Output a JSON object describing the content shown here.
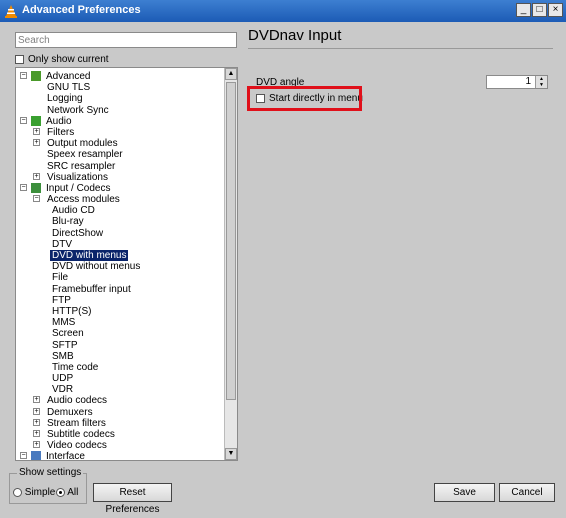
{
  "window": {
    "title": "Advanced Preferences",
    "controls": [
      "_",
      "□",
      "×"
    ]
  },
  "search": {
    "placeholder": "Search"
  },
  "only_show_current": {
    "label": "Only show current",
    "checked": false
  },
  "tree": {
    "items": [
      {
        "label": "Advanced",
        "level": 0,
        "expander": "−",
        "icon": "advanced-icon"
      },
      {
        "label": "GNU TLS",
        "level": 1
      },
      {
        "label": "Logging",
        "level": 1
      },
      {
        "label": "Network Sync",
        "level": 1
      },
      {
        "label": "Audio",
        "level": 0,
        "expander": "−",
        "icon": "music-note-icon"
      },
      {
        "label": "Filters",
        "level": 1,
        "expander": "+"
      },
      {
        "label": "Output modules",
        "level": 1,
        "expander": "+"
      },
      {
        "label": "Speex resampler",
        "level": 1
      },
      {
        "label": "SRC resampler",
        "level": 1
      },
      {
        "label": "Visualizations",
        "level": 1,
        "expander": "+"
      },
      {
        "label": "Input / Codecs",
        "level": 0,
        "expander": "−",
        "icon": "input-codecs-icon"
      },
      {
        "label": "Access modules",
        "level": 1,
        "expander": "−"
      },
      {
        "label": "Audio CD",
        "level": 2
      },
      {
        "label": "Blu-ray",
        "level": 2
      },
      {
        "label": "DirectShow",
        "level": 2
      },
      {
        "label": "DTV",
        "level": 2
      },
      {
        "label": "DVD with menus",
        "level": 2,
        "selected": true
      },
      {
        "label": "DVD without menus",
        "level": 2
      },
      {
        "label": "File",
        "level": 2
      },
      {
        "label": "Framebuffer input",
        "level": 2
      },
      {
        "label": "FTP",
        "level": 2
      },
      {
        "label": "HTTP(S)",
        "level": 2
      },
      {
        "label": "MMS",
        "level": 2
      },
      {
        "label": "Screen",
        "level": 2
      },
      {
        "label": "SFTP",
        "level": 2
      },
      {
        "label": "SMB",
        "level": 2
      },
      {
        "label": "Time code",
        "level": 2
      },
      {
        "label": "UDP",
        "level": 2
      },
      {
        "label": "VDR",
        "level": 2
      },
      {
        "label": "Audio codecs",
        "level": 1,
        "expander": "+"
      },
      {
        "label": "Demuxers",
        "level": 1,
        "expander": "+"
      },
      {
        "label": "Stream filters",
        "level": 1,
        "expander": "+"
      },
      {
        "label": "Subtitle codecs",
        "level": 1,
        "expander": "+"
      },
      {
        "label": "Video codecs",
        "level": 1,
        "expander": "+"
      },
      {
        "label": "Interface",
        "level": 0,
        "expander": "−",
        "icon": "interface-icon"
      }
    ]
  },
  "panel": {
    "title": "DVDnav Input",
    "dvd_angle_label": "DVD angle",
    "dvd_angle_value": "1",
    "start_menu_label": "Start directly in menu",
    "start_menu_checked": false
  },
  "bottom": {
    "show_settings_legend": "Show settings",
    "simple_label": "Simple",
    "all_label": "All",
    "selected_mode": "All",
    "reset_label": "Reset Preferences",
    "save_label": "Save",
    "cancel_label": "Cancel"
  },
  "colors": {
    "titlebar": "#1c5bb5",
    "selection": "#0a246a",
    "highlight_box": "#e0101a"
  }
}
